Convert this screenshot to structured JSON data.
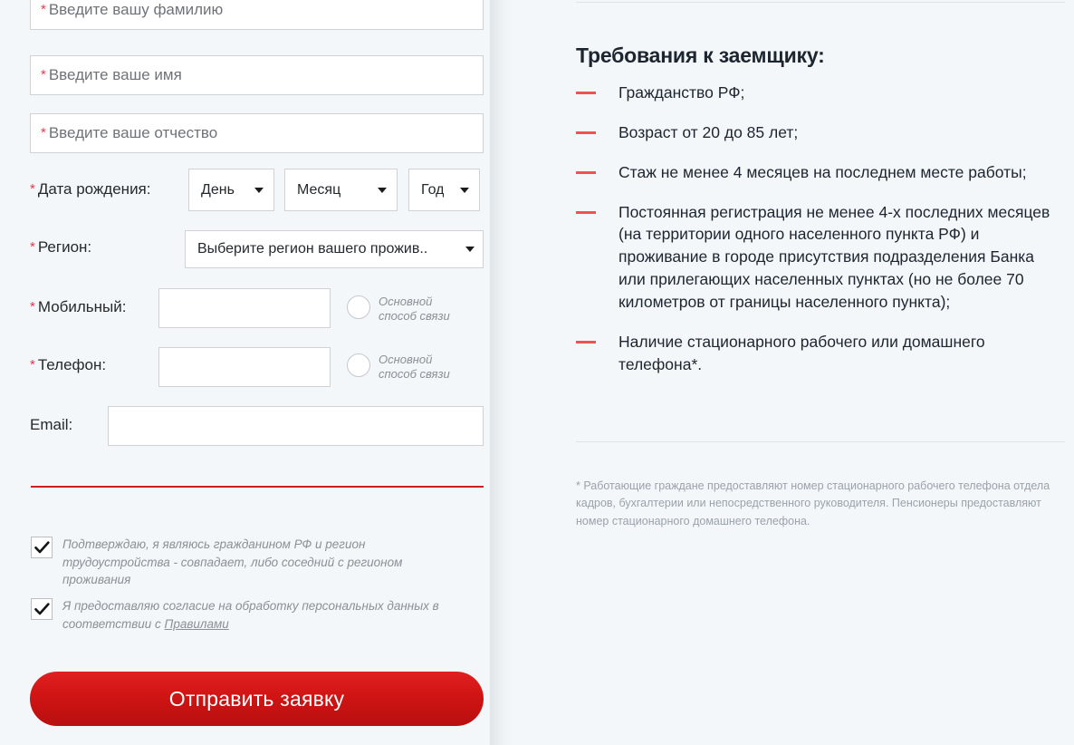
{
  "form": {
    "required_marker": "*",
    "fields": [
      {
        "name": "lastname",
        "placeholder": "Введите вашу фамилию",
        "value": "",
        "required": true
      },
      {
        "name": "firstname",
        "placeholder": "Введите ваше имя",
        "value": "",
        "required": true
      },
      {
        "name": "middlename",
        "placeholder": "Введите ваше отчество",
        "value": "",
        "required": true
      }
    ],
    "birthdate": {
      "label": "Дата рождения:",
      "required": true,
      "day": {
        "selected": "День"
      },
      "month": {
        "selected": "Месяц"
      },
      "year": {
        "selected": "Год"
      }
    },
    "region": {
      "label": "Регион:",
      "required": true,
      "selected": "Выберите регион вашего прожив.."
    },
    "mobile": {
      "label": "Мобильный:",
      "required": true,
      "value": "",
      "radio_label": "Основной способ связи",
      "radio_checked": false
    },
    "phone": {
      "label": "Телефон:",
      "required": true,
      "value": "",
      "radio_label": "Основной способ связи",
      "radio_checked": false
    },
    "email": {
      "label": "Email:",
      "required": false,
      "value": ""
    },
    "consents": [
      {
        "checked": true,
        "text": "Подтверждаю, я являюсь гражданином РФ и регион трудоустройства - совпадает, либо соседний с регионом проживания"
      },
      {
        "checked": true,
        "text_before": "Я предоставляю согласие на обработку персональных данных в соответствии с ",
        "link_text": "Правилами",
        "text_after": ""
      }
    ],
    "submit_label": "Отправить заявку"
  },
  "requirements": {
    "title": "Требования к заемщику:",
    "items": [
      "Гражданство РФ;",
      "Возраст от 20 до 85 лет;",
      "Стаж не менее 4 месяцев на последнем месте работы;",
      "Постоянная регистрация не менее 4-х последних месяцев (на территории одного населенного пункта РФ) и проживание в городе присутствия подразделения Банка или прилегающих населенных пунктах (но не более 70 километров от границы населенного пункта);",
      "Наличие стационарного рабочего или домашнего телефона*."
    ],
    "footnote": "* Работающие граждане предоставляют номер стационарного рабочего телефона отдела кадров, бухгалтерии или непосредственного руководителя. Пенсионеры предоставляют номер стационарного домашнего телефона."
  },
  "colors": {
    "accent_red": "#cc1f1f",
    "button_red": "#d01414",
    "dash_red": "#ef5350",
    "star_red": "#e8374a",
    "background": "#f4f7fa",
    "text_dark": "#1d2530",
    "text_muted": "#8a9096"
  },
  "icons": {
    "caret": "chevron-down-icon",
    "check": "check-icon",
    "dash": "dash-bullet-icon",
    "radio": "radio-unchecked-icon",
    "star": "required-asterisk-icon"
  }
}
